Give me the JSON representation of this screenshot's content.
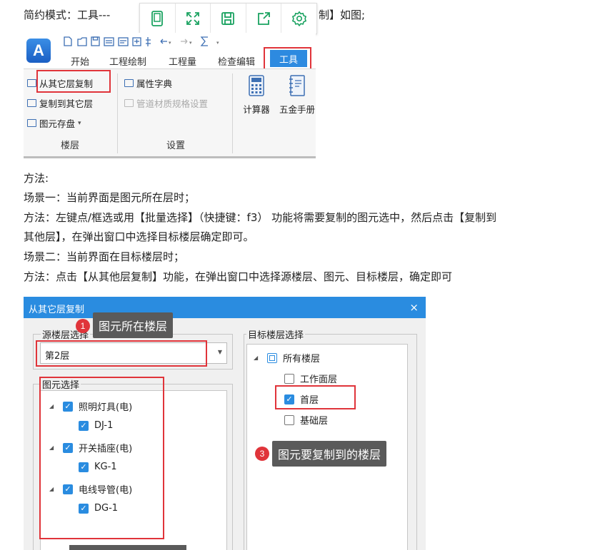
{
  "intro_text": "简约模式：工具---【从其它层复制】如图；",
  "intro_left": "简约模式：工具---",
  "intro_right": "制】如图;",
  "float_toolbar": {
    "icons": [
      "tablet-icon",
      "fullscreen-icon",
      "save-icon",
      "share-icon",
      "settings-icon"
    ],
    "color": "#1aa260"
  },
  "ribbon": {
    "logo_letter": "A",
    "tabs": [
      "开始",
      "工程绘制",
      "工程量",
      "检查编辑"
    ],
    "active_tab": "工具",
    "floor_group": {
      "items": [
        "从其它层复制",
        "复制到其它层",
        "图元存盘"
      ],
      "dropdown_arrow": "▾",
      "label": "楼层"
    },
    "settings_group": {
      "items": [
        "属性字典",
        "管道材质规格设置"
      ],
      "label": "设置"
    },
    "tools": [
      "计算器",
      "五金手册"
    ]
  },
  "body_lines": [
    "方法:",
    "场景一：当前界面是图元所在层时；",
    "方法：左键点/框选或用【批量选择】（快捷键：f3） 功能将需要复制的图元选中，然后点击【复制到",
    "其他层】，在弹出窗口中选择目标楼层确定即可。",
    "场景二：当前界面在目标楼层时；",
    "方法：点击【从其他层复制】功能，在弹出窗口中选择源楼层、图元、目标楼层，确定即可"
  ],
  "dialog": {
    "title": "从其它层复制",
    "close": "×",
    "source_floor": {
      "legend": "源楼层选择",
      "value": "第2层"
    },
    "element_select": {
      "legend": "图元选择",
      "tree": [
        {
          "label": "照明灯具(电)",
          "child": "DJ-1"
        },
        {
          "label": "开关插座(电)",
          "child": "KG-1"
        },
        {
          "label": "电线导管(电)",
          "child": "DG-1"
        }
      ]
    },
    "target_floor": {
      "legend": "目标楼层选择",
      "root": "所有楼层",
      "floors": [
        {
          "label": "工作面层",
          "checked": false
        },
        {
          "label": "首层",
          "checked": true
        },
        {
          "label": "基础层",
          "checked": false
        }
      ]
    }
  },
  "annotations": [
    {
      "num": "1",
      "text": "图元所在楼层"
    },
    {
      "num": "3",
      "text": "图元要复制到的楼层"
    }
  ],
  "colors": {
    "accent": "#2a8ce0",
    "highlight": "#e0343a",
    "tooltip_bg": "#5a5a5a"
  }
}
